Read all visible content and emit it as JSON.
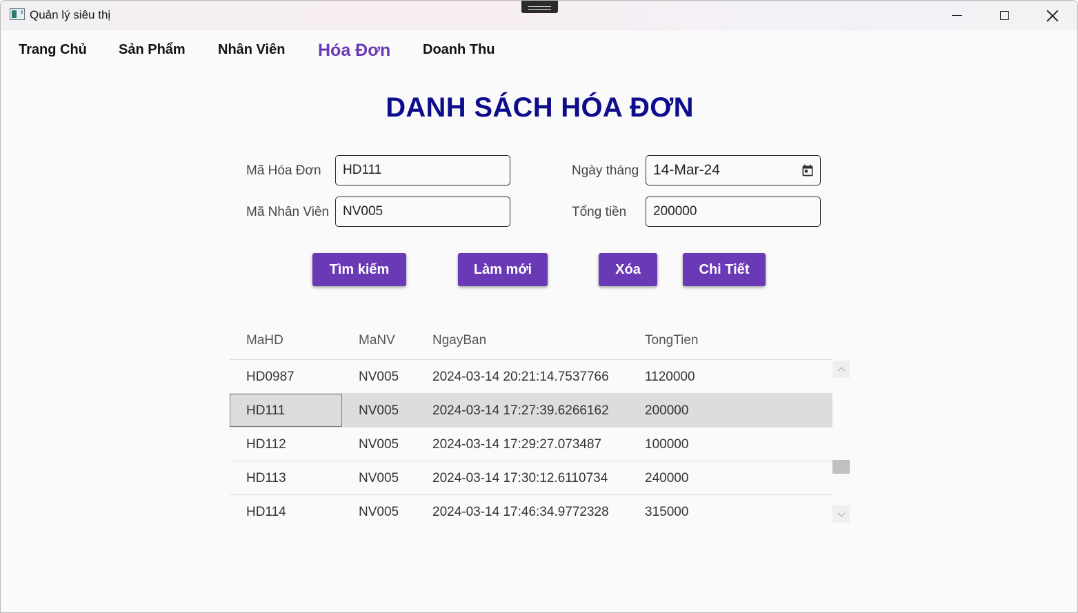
{
  "window": {
    "title": "Quản lý siêu thị"
  },
  "nav": {
    "items": [
      {
        "label": "Trang Chủ"
      },
      {
        "label": "Sản Phẩm"
      },
      {
        "label": "Nhân Viên"
      },
      {
        "label": "Hóa Đơn"
      },
      {
        "label": "Doanh Thu"
      }
    ],
    "active": "Hóa Đơn"
  },
  "page_title": "DANH SÁCH HÓA ĐƠN",
  "form": {
    "ma_hoa_don": {
      "label": "Mã Hóa Đơn",
      "value": "HD111"
    },
    "ma_nhan_vien": {
      "label": "Mã Nhân Viên",
      "value": "NV005"
    },
    "ngay_thang": {
      "label": "Ngày tháng",
      "value": "14-Mar-24"
    },
    "tong_tien": {
      "label": "Tổng tiền",
      "value": "200000"
    }
  },
  "buttons": {
    "search": "Tìm kiếm",
    "refresh": "Làm mới",
    "delete": "Xóa",
    "detail": "Chi Tiết"
  },
  "table": {
    "columns": [
      "MaHD",
      "MaNV",
      "NgayBan",
      "TongTien"
    ],
    "rows": [
      [
        "HD0987",
        "NV005",
        "2024-03-14 20:21:14.7537766",
        "1120000"
      ],
      [
        "HD111",
        "NV005",
        "2024-03-14 17:27:39.6266162",
        "200000"
      ],
      [
        "HD112",
        "NV005",
        "2024-03-14 17:29:27.073487",
        "100000"
      ],
      [
        "HD113",
        "NV005",
        "2024-03-14 17:30:12.6110734",
        "240000"
      ],
      [
        "HD114",
        "NV005",
        "2024-03-14 17:46:34.9772328",
        "315000"
      ]
    ],
    "selected_row": 1
  },
  "colors": {
    "accent": "#6a3ab6",
    "title": "#0c0c8c",
    "selected_row": "#dddddd"
  }
}
